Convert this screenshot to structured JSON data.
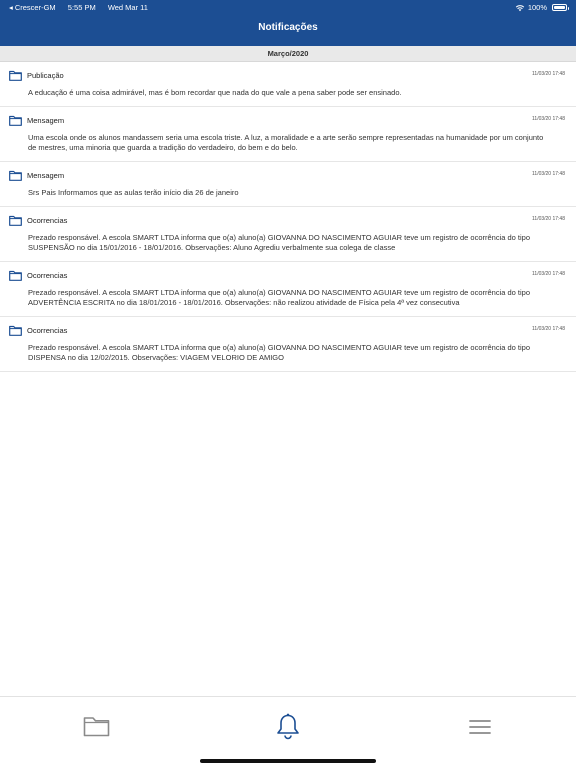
{
  "status_bar": {
    "back_app": "◂ Crescer-GM",
    "time": "5:55 PM",
    "date": "Wed Mar 11",
    "battery": "100%"
  },
  "header": {
    "title": "Notificações"
  },
  "section": {
    "label": "Março/2020"
  },
  "notifications": [
    {
      "type": "Publicação",
      "date": "11/03/20 17:48",
      "message": "A educação é uma coisa admirável, mas é bom recordar que nada do que vale a pena saber pode ser ensinado."
    },
    {
      "type": "Mensagem",
      "date": "11/03/20 17:48",
      "message": "Uma escola onde os alunos mandassem seria uma escola triste. A luz, a moralidade e a arte serão sempre representadas na humanidade por um conjunto de mestres, uma minoria que guarda a tradição do verdadeiro, do bem e do belo."
    },
    {
      "type": "Mensagem",
      "date": "11/03/20 17:48",
      "message": "Srs Pais Informamos que as aulas terão início dia 26 de janeiro"
    },
    {
      "type": "Ocorrencias",
      "date": "11/03/20 17:48",
      "message": "Prezado responsável. A escola SMART LTDA informa que o(a) aluno(a) GIOVANNA DO NASCIMENTO AGUIAR teve um registro de ocorrência do tipo SUSPENSÃO no dia 15/01/2016 - 18/01/2016. Observações: Aluno Agrediu verbalmente sua colega de classe"
    },
    {
      "type": "Ocorrencias",
      "date": "11/03/20 17:48",
      "message": "Prezado responsável. A escola SMART LTDA informa que o(a) aluno(a) GIOVANNA DO NASCIMENTO AGUIAR teve um registro de ocorrência do tipo ADVERTÊNCIA ESCRITA no dia 18/01/2016 - 18/01/2016. Observações: não realizou atividade de Física pela 4ª vez consecutiva"
    },
    {
      "type": "Ocorrencias",
      "date": "11/03/20 17:48",
      "message": "Prezado responsável. A escola SMART LTDA informa que o(a) aluno(a) GIOVANNA DO NASCIMENTO AGUIAR teve um registro de ocorrência do tipo DISPENSA no dia 12/02/2015. Observações: VIAGEM VELORIO DE AMIGO"
    }
  ],
  "tabbar": {
    "tabs": [
      {
        "icon": "folder-icon"
      },
      {
        "icon": "bell-icon",
        "active": true
      },
      {
        "icon": "menu-icon"
      }
    ]
  },
  "colors": {
    "header_bg": "#1c4e93",
    "accent": "#1c4e93",
    "inactive_icon": "#8a8a8a"
  }
}
